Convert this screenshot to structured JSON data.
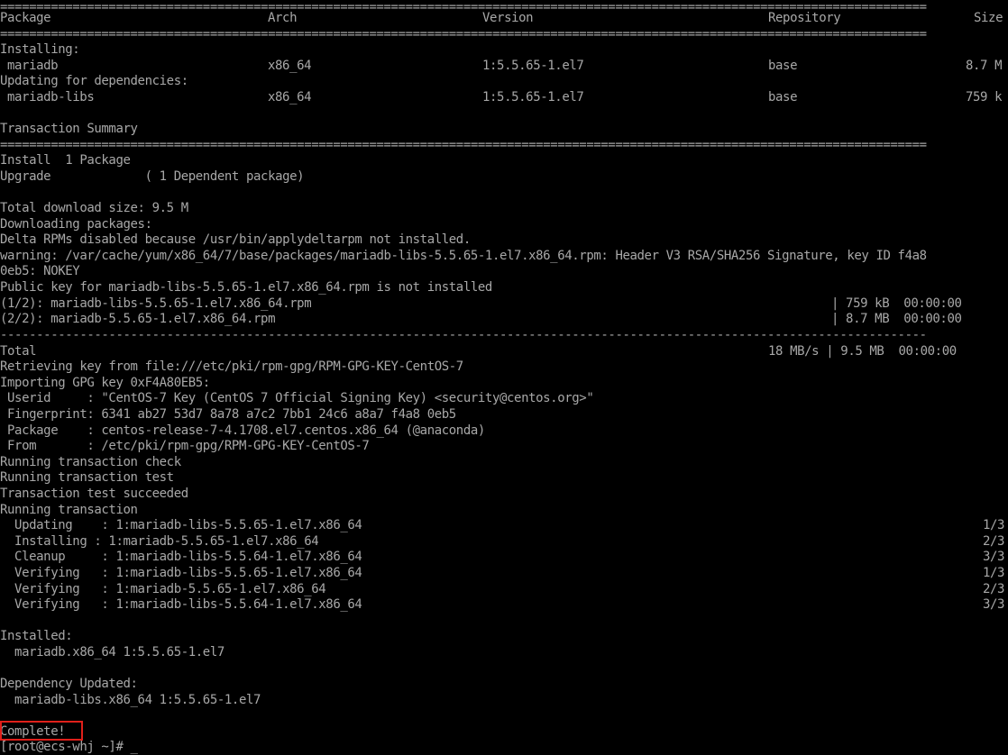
{
  "terminal": {
    "separator": "================================================================================================================================",
    "headers": {
      "package": "Package",
      "arch": "Arch",
      "version": "Version",
      "repository": "Repository",
      "size": "Size"
    },
    "installing_label": "Installing:",
    "updating_deps_label": "Updating for dependencies:",
    "packages": [
      {
        "name": "mariadb",
        "arch": "x86_64",
        "version": "1:5.5.65-1.el7",
        "repo": "base",
        "size": "8.7 M"
      },
      {
        "name": "mariadb-libs",
        "arch": "x86_64",
        "version": "1:5.5.65-1.el7",
        "repo": "base",
        "size": "759 k"
      }
    ],
    "transaction_summary": "Transaction Summary",
    "install_line": "Install  1 Package",
    "upgrade_line": "Upgrade             ( 1 Dependent package)",
    "total_download": "Total download size: 9.5 M",
    "downloading": "Downloading packages:",
    "delta_rpms": "Delta RPMs disabled because /usr/bin/applydeltarpm not installed.",
    "warning_line1": "warning: /var/cache/yum/x86_64/7/base/packages/mariadb-libs-5.5.65-1.el7.x86_64.rpm: Header V3 RSA/SHA256 Signature, key ID f4a8",
    "warning_line2": "0eb5: NOKEY",
    "public_key": "Public key for mariadb-libs-5.5.65-1.el7.x86_64.rpm is not installed",
    "downloads": [
      {
        "name": "(1/2): mariadb-libs-5.5.65-1.el7.x86_64.rpm",
        "size": "| 759 kB  00:00:00"
      },
      {
        "name": "(2/2): mariadb-5.5.65-1.el7.x86_64.rpm",
        "size": "| 8.7 MB  00:00:00"
      }
    ],
    "dash_separator": "--------------------------------------------------------------------------------------------------------------------------------",
    "total_label": "Total",
    "total_stats": "18 MB/s | 9.5 MB  00:00:00",
    "retrieving_key": "Retrieving key from file:///etc/pki/rpm-gpg/RPM-GPG-KEY-CentOS-7",
    "importing_key": "Importing GPG key 0xF4A80EB5:",
    "key_info": [
      " Userid     : \"CentOS-7 Key (CentOS 7 Official Signing Key) <security@centos.org>\"",
      " Fingerprint: 6341 ab27 53d7 8a78 a7c2 7bb1 24c6 a8a7 f4a8 0eb5",
      " Package    : centos-release-7-4.1708.el7.centos.x86_64 (@anaconda)",
      " From       : /etc/pki/rpm-gpg/RPM-GPG-KEY-CentOS-7"
    ],
    "transaction_steps": [
      "Running transaction check",
      "Running transaction test",
      "Transaction test succeeded",
      "Running transaction"
    ],
    "progress": [
      {
        "text": "  Updating    : 1:mariadb-libs-5.5.65-1.el7.x86_64",
        "count": "1/3"
      },
      {
        "text": "  Installing : 1:mariadb-5.5.65-1.el7.x86_64",
        "count": "2/3"
      },
      {
        "text": "  Cleanup     : 1:mariadb-libs-5.5.64-1.el7.x86_64",
        "count": "3/3"
      },
      {
        "text": "  Verifying   : 1:mariadb-libs-5.5.65-1.el7.x86_64",
        "count": "1/3"
      },
      {
        "text": "  Verifying   : 1:mariadb-5.5.65-1.el7.x86_64",
        "count": "2/3"
      },
      {
        "text": "  Verifying   : 1:mariadb-libs-5.5.64-1.el7.x86_64",
        "count": "3/3"
      }
    ],
    "installed_label": "Installed:",
    "installed_pkg": "  mariadb.x86_64 1:5.5.65-1.el7",
    "dep_updated_label": "Dependency Updated:",
    "dep_updated_pkg": "  mariadb-libs.x86_64 1:5.5.65-1.el7",
    "complete": "Complete!",
    "prompt": "[root@ecs-whj ~]# _"
  },
  "colors": {
    "background": "#000000",
    "text": "#a8a8a8",
    "highlight_border": "#e0201a"
  }
}
